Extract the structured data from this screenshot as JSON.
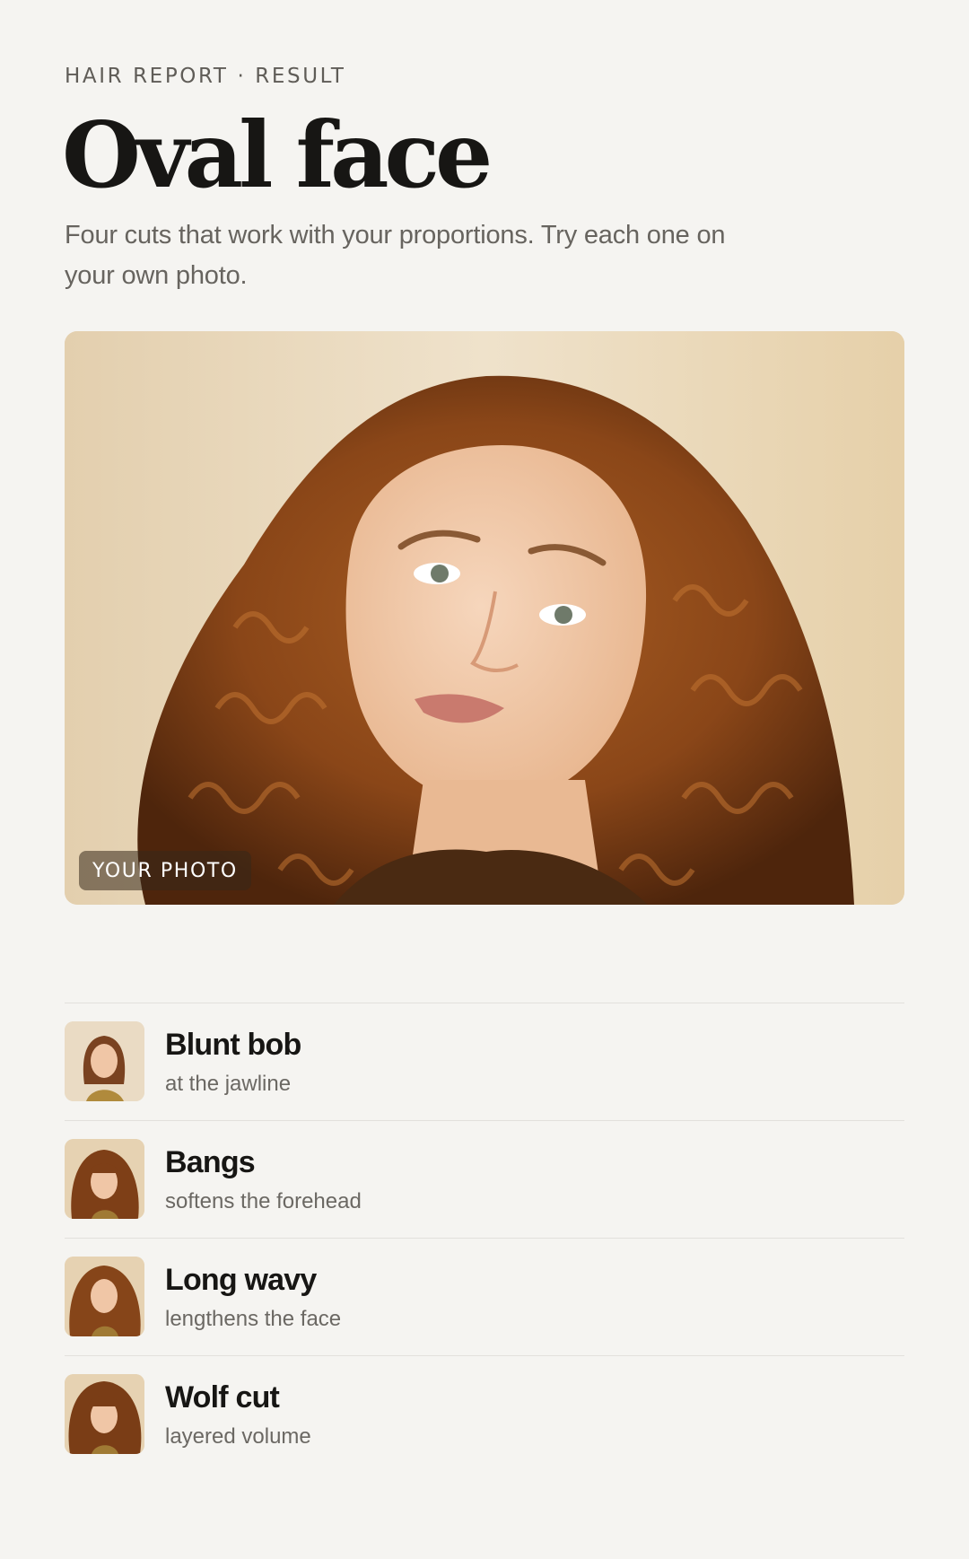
{
  "header": {
    "eyebrow": "HAIR REPORT · RESULT",
    "title": "Oval face",
    "subtitle": "Four cuts that work with your proportions. Try each one on your own photo."
  },
  "photo": {
    "badge": "YOUR PHOTO",
    "description_icon": "portrait-photo"
  },
  "styles": [
    {
      "name": "Blunt bob",
      "note": "at the jawline",
      "thumb_icon": "blunt-bob-thumbnail"
    },
    {
      "name": "Bangs",
      "note": "softens the forehead",
      "thumb_icon": "bangs-thumbnail"
    },
    {
      "name": "Long wavy",
      "note": "lengthens the face",
      "thumb_icon": "long-wavy-thumbnail"
    },
    {
      "name": "Wolf cut",
      "note": "layered volume",
      "thumb_icon": "wolf-cut-thumbnail"
    }
  ],
  "colors": {
    "background": "#f5f4f1",
    "title": "#171614",
    "muted": "#67645f",
    "hair": "#8a4a1c",
    "skin": "#f0c9aa"
  }
}
